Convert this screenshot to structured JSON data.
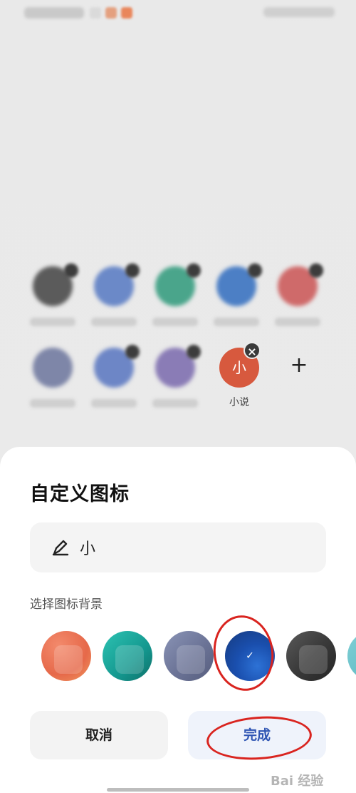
{
  "background_apps": {
    "grid": [
      {
        "color": "#5b5b5b"
      },
      {
        "color": "#6b89c8"
      },
      {
        "color": "#4aa58b"
      },
      {
        "color": "#4c7fc5"
      },
      {
        "color": "#cf6a6a"
      },
      {
        "color": "#7e86a8"
      },
      {
        "color": "#6d86c6"
      },
      {
        "color": "#8a7cb6"
      }
    ],
    "selected_app": {
      "icon_text": "小",
      "label": "小说",
      "color": "#d7593e"
    },
    "add_symbol": "+"
  },
  "sheet": {
    "title": "自定义图标",
    "name_field": {
      "value": "小",
      "icon": "pen-icon"
    },
    "background_label": "选择图标背景",
    "swatches": [
      {
        "name": "orange",
        "color": "#e8714f"
      },
      {
        "name": "teal",
        "color": "#18a79d"
      },
      {
        "name": "slate",
        "color": "#6f7799"
      },
      {
        "name": "blue",
        "color": "#1e52b0",
        "selected": true,
        "check": "✓"
      },
      {
        "name": "dark",
        "color": "#3a3a3a"
      },
      {
        "name": "cyan",
        "color": "#69c0c8"
      }
    ],
    "cancel_label": "取消",
    "done_label": "完成"
  },
  "watermark": "Bai 经验"
}
